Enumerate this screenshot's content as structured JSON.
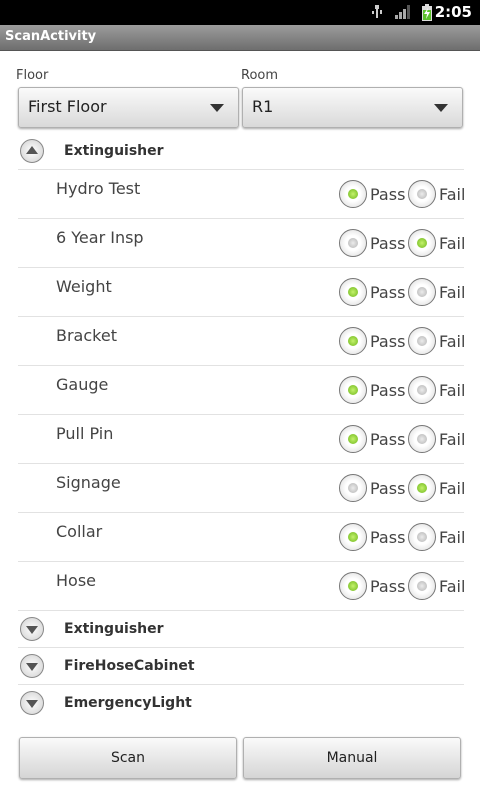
{
  "status": {
    "time": "2:05"
  },
  "app": {
    "title": "ScanActivity"
  },
  "floor": {
    "label": "Floor",
    "value": "First Floor"
  },
  "room": {
    "label": "Room",
    "value": "R1"
  },
  "radio_labels": {
    "pass": "Pass",
    "fail": "Fail"
  },
  "groups": [
    {
      "name": "Extinguisher",
      "expanded": true
    },
    {
      "name": "Extinguisher",
      "expanded": false
    },
    {
      "name": "FireHoseCabinet",
      "expanded": false
    },
    {
      "name": "EmergencyLight",
      "expanded": false
    }
  ],
  "items": [
    {
      "name": "Hydro Test",
      "result": "pass"
    },
    {
      "name": "6 Year Insp",
      "result": "fail"
    },
    {
      "name": "Weight",
      "result": "pass"
    },
    {
      "name": "Bracket",
      "result": "pass"
    },
    {
      "name": "Gauge",
      "result": "pass"
    },
    {
      "name": "Pull Pin",
      "result": "pass"
    },
    {
      "name": "Signage",
      "result": "fail"
    },
    {
      "name": "Collar",
      "result": "pass"
    },
    {
      "name": "Hose",
      "result": "pass"
    }
  ],
  "buttons": {
    "scan": "Scan",
    "manual": "Manual"
  }
}
